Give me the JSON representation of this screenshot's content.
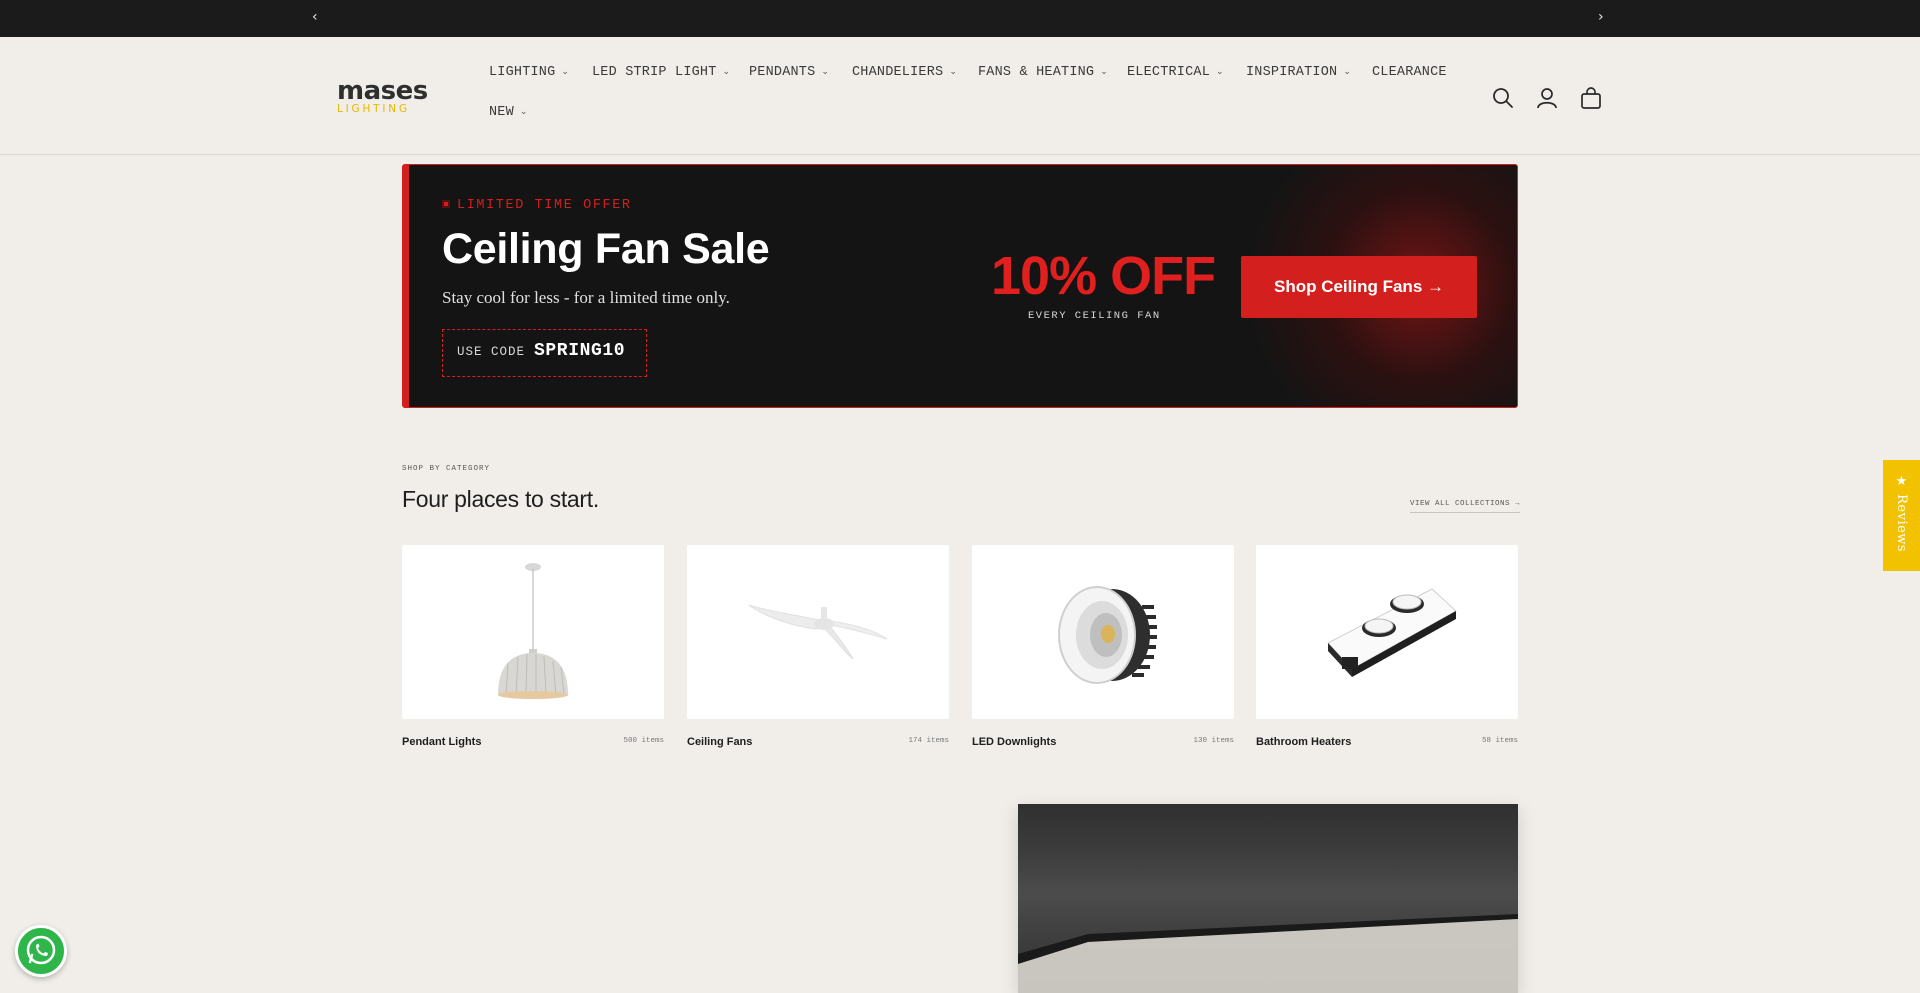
{
  "announcement": {
    "prev_icon": "chevron-left-icon",
    "next_icon": "chevron-right-icon"
  },
  "header": {
    "logo": {
      "word": "mases",
      "sub": "LIGHTING"
    },
    "nav": [
      {
        "label": "LIGHTING",
        "dropdown": true
      },
      {
        "label": "LED STRIP LIGHT",
        "dropdown": true
      },
      {
        "label": "PENDANTS",
        "dropdown": true
      },
      {
        "label": "CHANDELIERS",
        "dropdown": true
      },
      {
        "label": "FANS & HEATING",
        "dropdown": true
      },
      {
        "label": "ELECTRICAL",
        "dropdown": true
      },
      {
        "label": "INSPIRATION",
        "dropdown": true
      },
      {
        "label": "CLEARANCE",
        "dropdown": false
      },
      {
        "label": "NEW",
        "dropdown": true
      }
    ],
    "icons": [
      "search-icon",
      "account-icon",
      "cart-icon"
    ]
  },
  "promo": {
    "eyebrow": "LIMITED TIME OFFER",
    "title": "Ceiling Fan Sale",
    "subtitle": "Stay cool for less - for a limited time only.",
    "code_label": "USE CODE",
    "code": "SPRING10",
    "discount": "10% OFF",
    "discount_sub": "EVERY CEILING FAN",
    "cta": "Shop Ceiling Fans →",
    "accent_color": "#d41f1f"
  },
  "categories": {
    "eyebrow": "SHOP BY CATEGORY",
    "title": "Four places to start.",
    "view_all": "VIEW ALL COLLECTIONS →",
    "items": [
      {
        "name": "Pendant Lights",
        "count": "500 items"
      },
      {
        "name": "Ceiling Fans",
        "count": "174 items"
      },
      {
        "name": "LED Downlights",
        "count": "130 items"
      },
      {
        "name": "Bathroom Heaters",
        "count": "58 items"
      }
    ]
  },
  "reviews_tab": {
    "label": "★ Reviews",
    "color": "#f2c200"
  },
  "whatsapp": {
    "icon": "whatsapp-icon",
    "color": "#2fb64a"
  }
}
